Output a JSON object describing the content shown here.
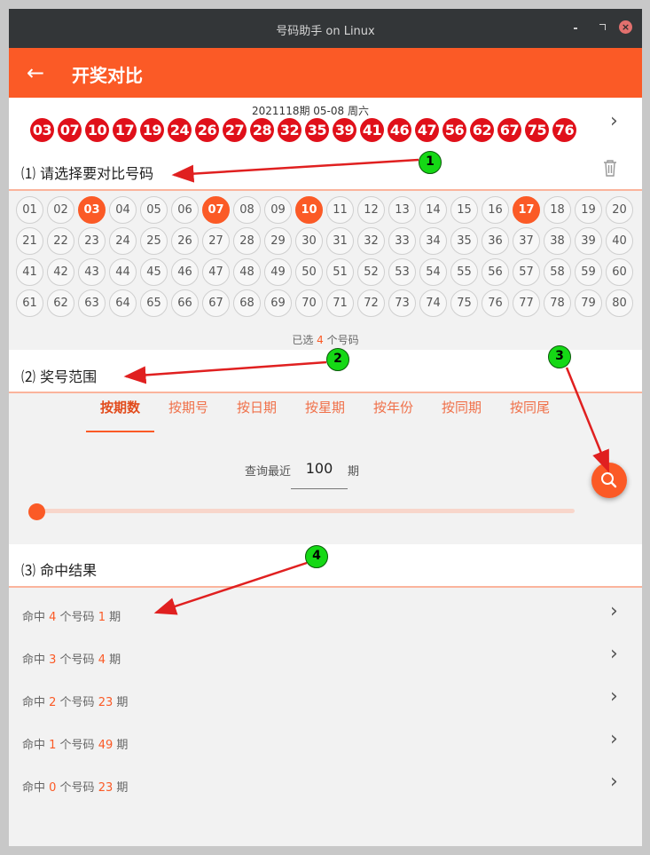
{
  "window": {
    "title": "号码助手 on Linux",
    "close_glyph": "×"
  },
  "appbar": {
    "title": "开奖对比",
    "back_icon": "arrow-left-icon"
  },
  "draw": {
    "caption": "2021118期  05-08 周六",
    "numbers": [
      "03",
      "07",
      "10",
      "17",
      "19",
      "24",
      "26",
      "27",
      "28",
      "32",
      "35",
      "39",
      "41",
      "46",
      "47",
      "56",
      "62",
      "67",
      "75",
      "76"
    ]
  },
  "section1": {
    "title": "⑴ 请选择要对比号码",
    "numbers": [
      "01",
      "02",
      "03",
      "04",
      "05",
      "06",
      "07",
      "08",
      "09",
      "10",
      "11",
      "12",
      "13",
      "14",
      "15",
      "16",
      "17",
      "18",
      "19",
      "20",
      "21",
      "22",
      "23",
      "24",
      "25",
      "26",
      "27",
      "28",
      "29",
      "30",
      "31",
      "32",
      "33",
      "34",
      "35",
      "36",
      "37",
      "38",
      "39",
      "40",
      "41",
      "42",
      "43",
      "44",
      "45",
      "46",
      "47",
      "48",
      "49",
      "50",
      "51",
      "52",
      "53",
      "54",
      "55",
      "56",
      "57",
      "58",
      "59",
      "60",
      "61",
      "62",
      "63",
      "64",
      "65",
      "66",
      "67",
      "68",
      "69",
      "70",
      "71",
      "72",
      "73",
      "74",
      "75",
      "76",
      "77",
      "78",
      "79",
      "80"
    ],
    "selected": [
      "03",
      "07",
      "10",
      "17"
    ],
    "selected_prefix": "已选 ",
    "selected_count": "4",
    "selected_suffix": " 个号码"
  },
  "section2": {
    "title": "⑵ 奖号范围",
    "tabs": [
      "按期数",
      "按期号",
      "按日期",
      "按星期",
      "按年份",
      "按同期",
      "按同尾"
    ],
    "active_tab": 0,
    "query_label": "查询最近",
    "query_value": "100",
    "query_unit": "期",
    "slider_level": 0
  },
  "section3": {
    "title": "⑶ 命中结果",
    "results": [
      {
        "prefix": "命中 ",
        "hits": "4",
        "mid": " 个号码 ",
        "count": "1",
        "suffix": " 期"
      },
      {
        "prefix": "命中 ",
        "hits": "3",
        "mid": " 个号码 ",
        "count": "4",
        "suffix": " 期"
      },
      {
        "prefix": "命中 ",
        "hits": "2",
        "mid": " 个号码 ",
        "count": "23",
        "suffix": " 期"
      },
      {
        "prefix": "命中 ",
        "hits": "1",
        "mid": " 个号码 ",
        "count": "49",
        "suffix": " 期"
      },
      {
        "prefix": "命中 ",
        "hits": "0",
        "mid": " 个号码 ",
        "count": "23",
        "suffix": " 期"
      }
    ]
  },
  "callouts": [
    "1",
    "2",
    "3",
    "4"
  ],
  "colors": {
    "accent": "#fb5a26",
    "draw_ball": "#e0101a",
    "callout": "#15d815",
    "arrow": "#e02020"
  }
}
